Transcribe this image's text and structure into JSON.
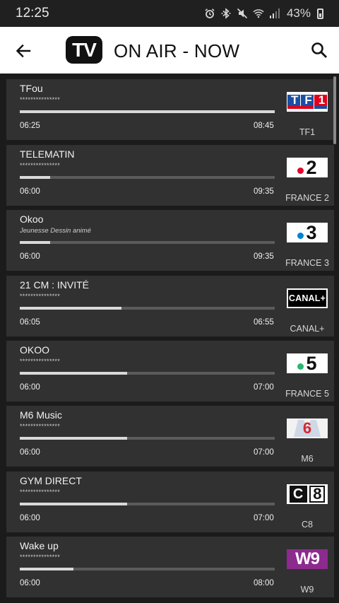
{
  "status_bar": {
    "time": "12:25",
    "battery": "43%",
    "icons": [
      "alarm-icon",
      "bluetooth-icon",
      "mute-icon",
      "wifi-icon",
      "signal-icon",
      "battery-icon"
    ]
  },
  "header": {
    "logo_text": "TV",
    "title": "ON AIR - NOW",
    "back_icon": "arrow-left-icon",
    "search_icon": "search-icon"
  },
  "programs": [
    {
      "title": "TFou",
      "subtitle": "***************",
      "start": "06:25",
      "end": "08:45",
      "progress": 1.0,
      "channel": "TF1",
      "logo": "tf1-logo"
    },
    {
      "title": "TELEMATIN",
      "subtitle": "***************",
      "start": "06:00",
      "end": "09:35",
      "progress": 0.12,
      "channel": "FRANCE 2",
      "logo": "france2-logo"
    },
    {
      "title": "Okoo",
      "subtitle": "Jeunesse Dessin animé",
      "start": "06:00",
      "end": "09:35",
      "progress": 0.12,
      "channel": "FRANCE 3",
      "logo": "france3-logo"
    },
    {
      "title": "21 CM : INVITÉ",
      "subtitle": "***************",
      "start": "06:05",
      "end": "06:55",
      "progress": 0.4,
      "channel": "CANAL+",
      "logo": "canalplus-logo"
    },
    {
      "title": "OKOO",
      "subtitle": "***************",
      "start": "06:00",
      "end": "07:00",
      "progress": 0.42,
      "channel": "FRANCE 5",
      "logo": "france5-logo"
    },
    {
      "title": "M6 Music",
      "subtitle": "***************",
      "start": "06:00",
      "end": "07:00",
      "progress": 0.42,
      "channel": "M6",
      "logo": "m6-logo"
    },
    {
      "title": "GYM DIRECT",
      "subtitle": "***************",
      "start": "06:00",
      "end": "07:00",
      "progress": 0.42,
      "channel": "C8",
      "logo": "c8-logo"
    },
    {
      "title": "Wake up",
      "subtitle": "***************",
      "start": "06:00",
      "end": "08:00",
      "progress": 0.21,
      "channel": "W9",
      "logo": "w9-logo"
    }
  ],
  "logo_text": {
    "tf1": "TF1",
    "france2": "2",
    "france3": "3",
    "canalplus": "CANAL+",
    "france5": "5",
    "m6": "6",
    "c8_c": "C",
    "c8_8": "8",
    "w9": "W9"
  },
  "colors": {
    "card_background": "#313131",
    "page_background": "#1b1b1b",
    "progress_track": "#5b5b5b",
    "progress_fill": "#d9d9d9",
    "tf1_red": "#e2001a",
    "tf1_blue": "#1a4fa3",
    "france2_red": "#e3002b",
    "france3_blue": "#0084d1",
    "france5_green": "#2bb673",
    "m6_red": "#d8272f",
    "w9_purple": "#8c2a8e"
  }
}
